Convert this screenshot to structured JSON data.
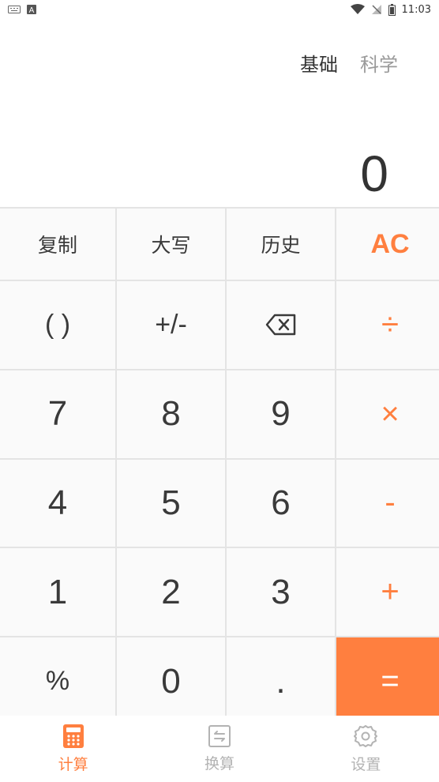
{
  "status_bar": {
    "time": "11:03",
    "left_icons": [
      "keyboard-icon",
      "a-notification-icon"
    ],
    "right_icons": [
      "wifi-icon",
      "no-sim-icon",
      "battery-icon"
    ]
  },
  "mode_tabs": [
    {
      "label": "基础",
      "active": true
    },
    {
      "label": "科学",
      "active": false
    }
  ],
  "display": {
    "value": "0"
  },
  "keys": {
    "copy": "复制",
    "uppercase": "大写",
    "history": "历史",
    "ac": "AC",
    "parens": "( )",
    "negate": "+/-",
    "divide": "÷",
    "seven": "7",
    "eight": "8",
    "nine": "9",
    "multiply": "×",
    "four": "4",
    "five": "5",
    "six": "6",
    "minus": "-",
    "one": "1",
    "two": "2",
    "three": "3",
    "plus": "+",
    "percent": "%",
    "zero": "0",
    "decimal": ".",
    "equals": "="
  },
  "bottom_nav": [
    {
      "label": "计算",
      "icon": "calculator-icon",
      "active": true
    },
    {
      "label": "换算",
      "icon": "convert-icon",
      "active": false
    },
    {
      "label": "设置",
      "icon": "gear-icon",
      "active": false
    }
  ],
  "colors": {
    "accent": "#ff7f3f",
    "text": "#333333",
    "inactive": "#b3b3b3",
    "key_bg": "#fafafa",
    "grid_line": "#e4e4e4"
  }
}
